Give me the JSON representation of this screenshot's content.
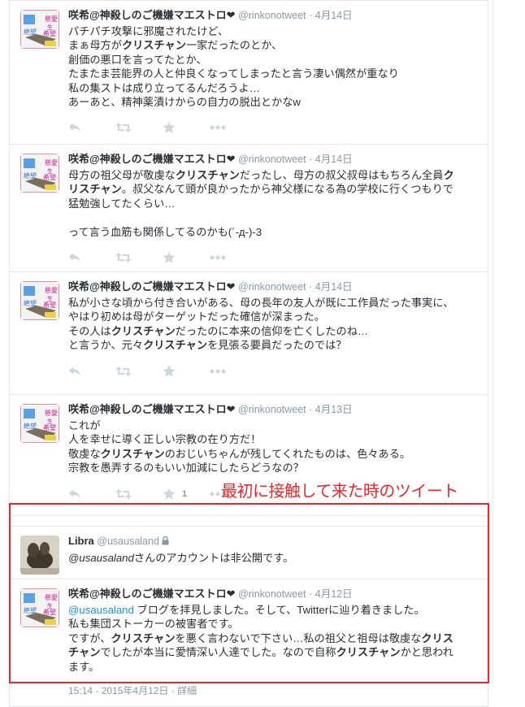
{
  "annotation": "最初に接触して来た時のツイート",
  "colors": {
    "annotation_red": "#e8262b",
    "link_blue": "#1b95e0",
    "muted": "#8899a6"
  },
  "icons": {
    "reply": "reply-icon",
    "retweet": "retweet-icon",
    "favorite": "star-icon",
    "more": "more-dots-icon",
    "lock": "lock-icon"
  },
  "tweets": [
    {
      "name": "咲希@神殺しのご機嫌マエストロ❤",
      "handle": "@rinkonotweet",
      "sep": "·",
      "date": "4月14日",
      "lines": [
        [
          {
            "t": "パチパチ攻撃に邪魔されたけど、"
          }
        ],
        [
          {
            "t": "まぁ母方が"
          },
          {
            "t": "クリスチャン",
            "b": true
          },
          {
            "t": "一家だったのとか、"
          }
        ],
        [
          {
            "t": "創価の悪口を言ってたとか、"
          }
        ],
        [
          {
            "t": "たまたま芸能界の人と仲良くなってしまったと言う凄い偶然が重なり"
          }
        ],
        [
          {
            "t": "私の集ストは成り立ってるんだろうよ…"
          }
        ],
        [
          {
            "t": "あーあと、精神薬漬けからの自力の脱出とかなw"
          }
        ]
      ],
      "retweet_count": ""
    },
    {
      "name": "咲希@神殺しのご機嫌マエストロ❤",
      "handle": "@rinkonotweet",
      "sep": "·",
      "date": "4月14日",
      "lines": [
        [
          {
            "t": "母方の祖父母が敬虔な"
          },
          {
            "t": "クリスチャン",
            "b": true
          },
          {
            "t": "だったし、母方の叔父叔母はもちろん全員"
          },
          {
            "t": "ク",
            "b": true
          }
        ],
        [
          {
            "t": "リスチャン",
            "b": true
          },
          {
            "t": "。叔父なんて頭が良かったから神父様になる為の学校に行くつもりで"
          }
        ],
        [
          {
            "t": "猛勉強してたくらい…"
          }
        ],
        [
          {
            "t": " "
          }
        ],
        [
          {
            "t": "って言う血筋も関係してるのかも(´-д-)-3"
          }
        ]
      ],
      "retweet_count": ""
    },
    {
      "name": "咲希@神殺しのご機嫌マエストロ❤",
      "handle": "@rinkonotweet",
      "sep": "·",
      "date": "4月14日",
      "lines": [
        [
          {
            "t": "私が小さな頃から付き合いがある、母の長年の友人が既に工作員だった事実に、"
          }
        ],
        [
          {
            "t": "やはり初めは母がターゲットだった確信が深まった。"
          }
        ],
        [
          {
            "t": "その人は"
          },
          {
            "t": "クリスチャン",
            "b": true
          },
          {
            "t": "だったのに本来の信仰を亡くしたのね…"
          }
        ],
        [
          {
            "t": "と言うか、元々"
          },
          {
            "t": "クリスチャン",
            "b": true
          },
          {
            "t": "を見張る要員だったのでは？"
          }
        ]
      ],
      "retweet_count": ""
    },
    {
      "name": "咲希@神殺しのご機嫌マエストロ❤",
      "handle": "@rinkonotweet",
      "sep": "·",
      "date": "4月13日",
      "lines": [
        [
          {
            "t": "これが"
          }
        ],
        [
          {
            "t": "人を幸せに導く正しい宗教の在り方だ！"
          }
        ],
        [
          {
            "t": "敬虔な"
          },
          {
            "t": "クリスチャン",
            "b": true
          },
          {
            "t": "のおじいちゃんが残してくれたものは、色々ある。"
          }
        ],
        [
          {
            "t": "宗教を愚弄するのもいい加減にしたらどうなの？"
          }
        ]
      ],
      "retweet_count": "1"
    }
  ],
  "protected_tweet": {
    "name": "Libra",
    "handle": "@usausaland",
    "mention": "@usausaland",
    "text": "さんのアカウントは非公開です。"
  },
  "reply_tweet": {
    "name": "咲希@神殺しのご機嫌マエストロ❤",
    "handle": "@rinkonotweet",
    "sep": "·",
    "date": "4月12日",
    "lines": [
      [
        {
          "t": "@usausaland",
          "m": true
        },
        {
          "t": " ブログを拝見しました。そして、Twitterに辿り着きました。"
        }
      ],
      [
        {
          "t": "私も集団ストーカーの被害者です。"
        }
      ],
      [
        {
          "t": "ですが、"
        },
        {
          "t": "クリスチャン",
          "b": true
        },
        {
          "t": "を悪く言わないで下さい…私の祖父と祖母は敬虔な"
        },
        {
          "t": "クリス",
          "b": true
        }
      ],
      [
        {
          "t": "チャン",
          "b": true
        },
        {
          "t": "でしたが本当に愛情深い人達でした。なので自称"
        },
        {
          "t": "クリスチャン",
          "b": true
        },
        {
          "t": "かと思われ"
        }
      ],
      [
        {
          "t": "ます。"
        }
      ]
    ],
    "timestamp": "15:14 - 2015年4月12日",
    "details": "詳細"
  }
}
